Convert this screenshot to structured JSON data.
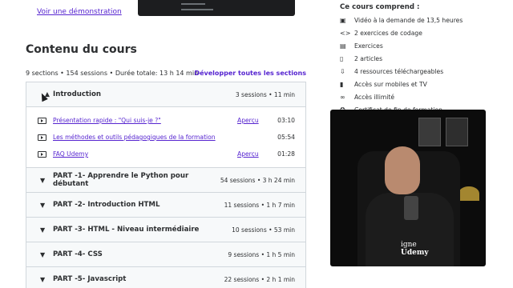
{
  "demo_link": "Voir une démonstration",
  "course_content": {
    "title": "Contenu du cours",
    "meta": "9 sections • 154 sessions • Durée totale: 13 h 14 min",
    "expand_all": "Développer toutes les sections"
  },
  "sections": [
    {
      "title": "Introduction",
      "info": "3 sessions • 11 min",
      "expanded": true,
      "lectures": [
        {
          "title": "Présentation rapide : \"Qui suis-je ?\"",
          "preview": "Aperçu",
          "duration": "03:10"
        },
        {
          "title": "Les méthodes et outils pédagogiques de la formation",
          "preview": "",
          "duration": "05:54"
        },
        {
          "title": "FAQ Udemy",
          "preview": "Aperçu",
          "duration": "01:28"
        }
      ]
    },
    {
      "title": "PART -1- Apprendre le Python pour débutant",
      "info": "54 sessions • 3 h 24 min"
    },
    {
      "title": "PART -2- Introduction HTML",
      "info": "11 sessions • 1 h 7 min"
    },
    {
      "title": "PART -3- HTML - Niveau intermédiaire",
      "info": "10 sessions • 53 min"
    },
    {
      "title": "PART -4- CSS",
      "info": "9 sessions • 1 h 5 min"
    },
    {
      "title": "PART -5- Javascript",
      "info": "22 sessions • 2 h 1 min"
    }
  ],
  "sidebar": {
    "title": "Ce cours comprend :",
    "items": [
      {
        "icon": "video-icon",
        "label": "Vidéo à la demande de 13,5 heures"
      },
      {
        "icon": "code-icon",
        "label": "2 exercices de codage"
      },
      {
        "icon": "exercise-icon",
        "label": "Exercices"
      },
      {
        "icon": "article-icon",
        "label": "2 articles"
      },
      {
        "icon": "download-icon",
        "label": "4 ressources téléchargeables"
      },
      {
        "icon": "mobile-icon",
        "label": "Accès sur mobiles et TV"
      },
      {
        "icon": "infinity-icon",
        "label": "Accès illimité"
      },
      {
        "icon": "certificate-icon",
        "label": "Certificat de fin de formation"
      }
    ]
  },
  "video": {
    "shirt_text_line1": "igne",
    "shirt_text_line2": "Udemy"
  }
}
